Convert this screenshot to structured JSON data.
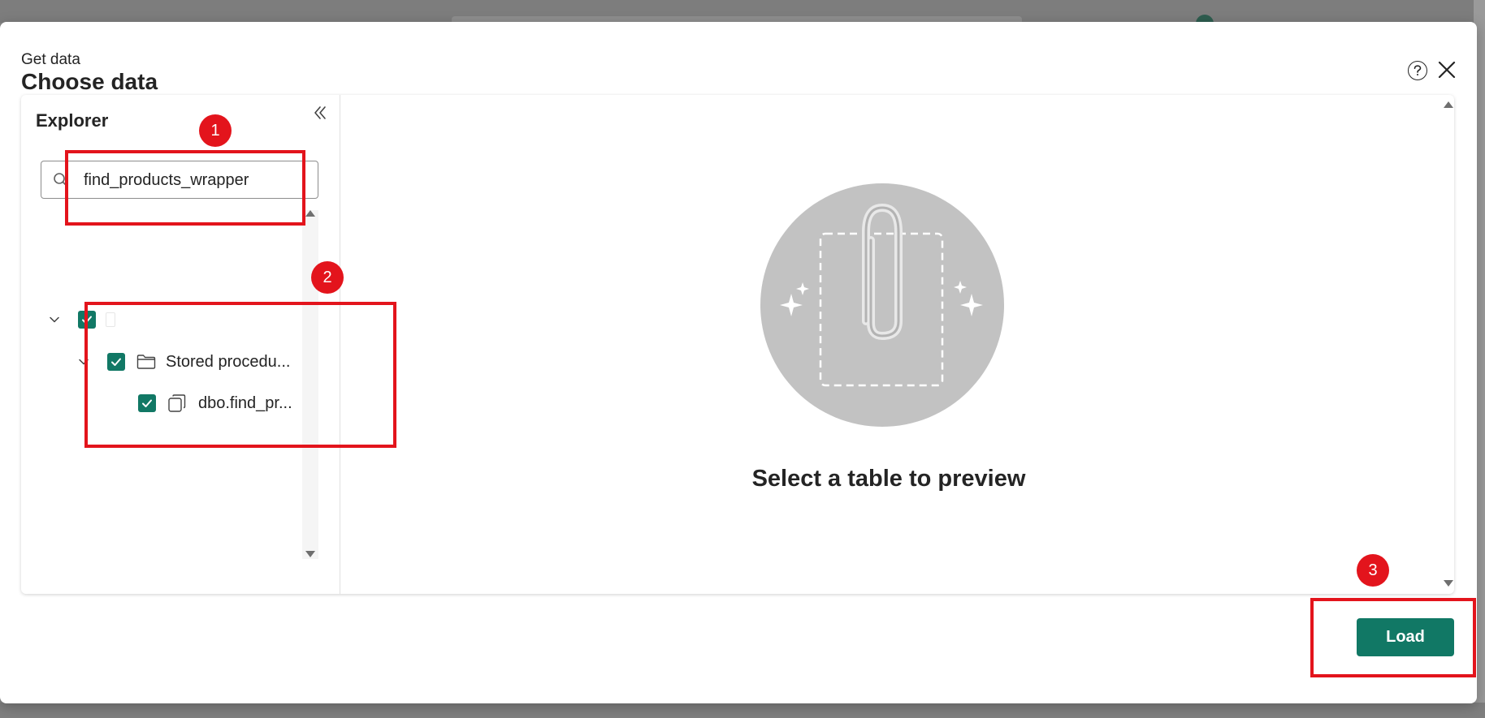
{
  "dialog": {
    "breadcrumb": "Get data",
    "title": "Choose data",
    "help_icon": "help-circle-icon",
    "close_icon": "close-icon"
  },
  "explorer": {
    "title": "Explorer",
    "collapse_icon": "double-chevron-left-icon",
    "search": {
      "value": "find_products_wrapper",
      "icon": "search-icon"
    },
    "tree": [
      {
        "label": "",
        "checked": true,
        "expanded": true,
        "icon": "database-icon"
      },
      {
        "label": "Stored procedu...",
        "checked": true,
        "expanded": true,
        "icon": "folder-icon"
      },
      {
        "label": "dbo.find_pr...",
        "checked": true,
        "icon": "stored-procedure-icon"
      }
    ]
  },
  "preview": {
    "message": "Select a table to preview",
    "illustration": "paperclip-icon"
  },
  "footer": {
    "load_label": "Load"
  },
  "annotations": {
    "badges": [
      "1",
      "2",
      "3"
    ],
    "color": "#e3141c"
  },
  "colors": {
    "accent": "#117865",
    "annotation": "#e3141c"
  }
}
